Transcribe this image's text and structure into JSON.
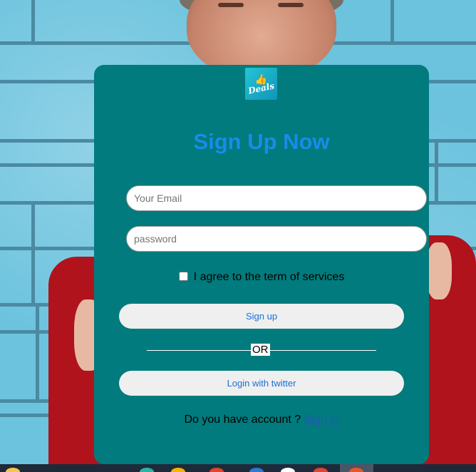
{
  "logo": {
    "text": "Deals",
    "thumb_glyph": "👍"
  },
  "form": {
    "title": "Sign Up Now",
    "email_placeholder": "Your Email",
    "password_placeholder": "password",
    "agree_label": "I agree to the term of services",
    "signup_label": "Sign up",
    "divider_text": "OR",
    "twitter_label": "Login with twitter",
    "account_prompt": "Do you have account ?",
    "signin_link": "Sign in"
  },
  "colors": {
    "card": "#017b7d",
    "title": "#1a8be8",
    "button_text": "#1a6fd6",
    "background_wall": "#6cc3de",
    "sweater": "#b0131b"
  }
}
